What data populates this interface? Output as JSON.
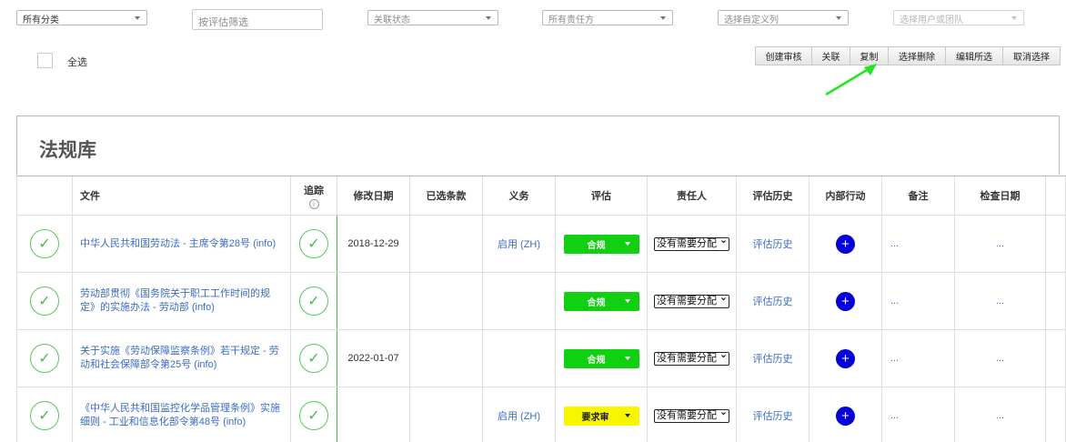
{
  "filters": {
    "category": "所有分类",
    "eval_placeholder": "按评估筛选",
    "relation": "关联状态",
    "owner": "所有责任方",
    "custom": "选择自定义列",
    "user_team": "选择用户或团队"
  },
  "select_all": "全选",
  "toolbar": [
    "创建审核",
    "关联",
    "复制",
    "选择删除",
    "编辑所选",
    "取消选择"
  ],
  "library_title": "法规库",
  "columns": {
    "doc": "文件",
    "track": "追踪",
    "track_info_icon": "i",
    "modified": "修改日期",
    "clauses": "已选条款",
    "obligation": "义务",
    "evaluation": "评估",
    "owner": "责任人",
    "history": "评估历史",
    "action": "内部行动",
    "notes": "备注",
    "check_date": "检查日期"
  },
  "rows": [
    {
      "doc": "中华人民共和国劳动法 - 主席令第28号 (info)",
      "modified": "2018-12-29",
      "obligation": "启用 (ZH)",
      "evaluation": "合规",
      "evaluation_color": "#11cf11",
      "owner": "没有需要分配",
      "history": "评估历史",
      "notes": "...",
      "check_date": "..."
    },
    {
      "doc": "劳动部贯彻《国务院关于职工工作时间的规定》的实施办法 - 劳动部 (info)",
      "modified": "",
      "obligation": "",
      "evaluation": "合规",
      "evaluation_color": "#11cf11",
      "owner": "没有需要分配",
      "history": "评估历史",
      "notes": "...",
      "check_date": "..."
    },
    {
      "doc": "关于实施《劳动保障监察条例》若干规定 - 劳动和社会保障部令第25号 (info)",
      "modified": "2022-01-07",
      "obligation": "",
      "evaluation": "合规",
      "evaluation_color": "#11cf11",
      "owner": "没有需要分配",
      "history": "评估历史",
      "notes": "...",
      "check_date": "..."
    },
    {
      "doc": "《中华人民共和国监控化学品管理条例》实施细则 - 工业和信息化部令第48号 (info)",
      "modified": "",
      "obligation": "启用 (ZH)",
      "evaluation": "要求审",
      "evaluation_color": "#f7f500",
      "owner": "没有需要分配",
      "history": "评估历史",
      "notes": "...",
      "check_date": "..."
    }
  ]
}
